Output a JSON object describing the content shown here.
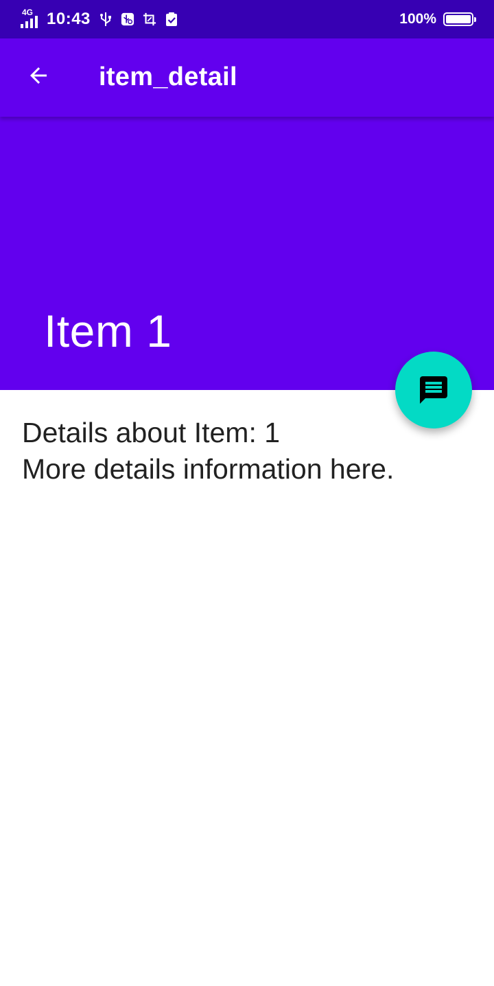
{
  "status_bar": {
    "network": "4G",
    "time": "10:43",
    "battery_percent": "100%",
    "icons": [
      "signal-icon",
      "usb-icon",
      "usb-debug-icon",
      "screenshot-icon",
      "clipboard-check-icon",
      "battery-icon"
    ]
  },
  "app_bar": {
    "title": "item_detail",
    "back_icon": "arrow-back-icon"
  },
  "header": {
    "title": "Item 1"
  },
  "fab": {
    "icon": "message-icon"
  },
  "content": {
    "line1": "Details about Item: 1",
    "line2": "More details information here."
  },
  "colors": {
    "status_bar": "#3700B3",
    "primary": "#6200EE",
    "accent": "#03DAC5",
    "text_primary": "#212121",
    "background": "#FFFFFF"
  }
}
